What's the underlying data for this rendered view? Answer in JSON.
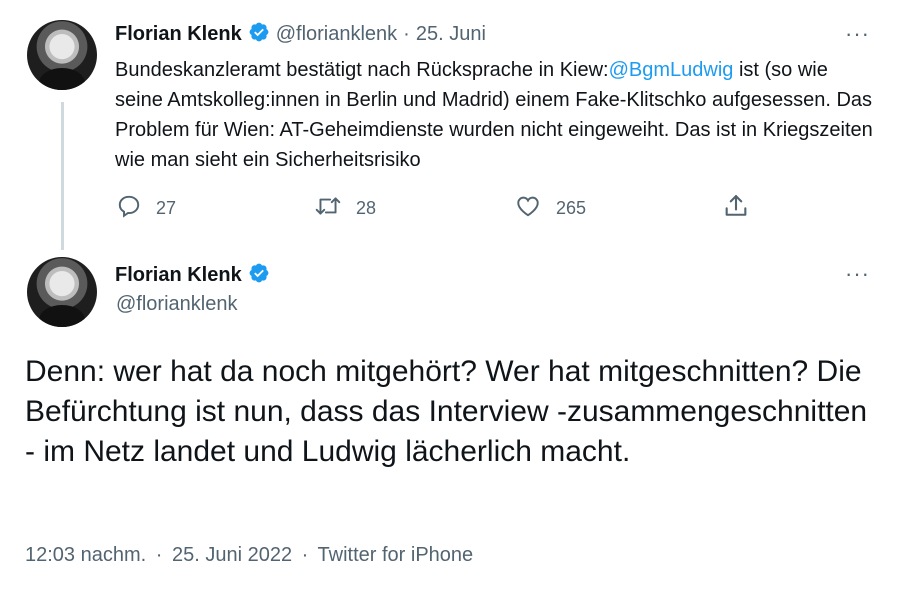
{
  "tweet1": {
    "author_name": "Florian Klenk",
    "handle": "@florianklenk",
    "separator": "·",
    "date": "25. Juni",
    "text_before": "Bundeskanzleramt bestätigt nach Rücksprache in Kiew:",
    "mention": "@BgmLudwig",
    "text_after": " ist (so wie seine Amtskolleg:innen in Berlin und Madrid) einem Fake-Klitschko aufgesessen. Das Problem für Wien: AT-Geheimdienste wurden nicht eingeweiht. Das ist in Kriegszeiten wie man sieht ein Sicherheitsrisiko",
    "replies": "27",
    "retweets": "28",
    "likes": "265",
    "more_label": "···"
  },
  "tweet2": {
    "author_name": "Florian Klenk",
    "handle": "@florianklenk",
    "more_label": "···",
    "text": "Denn: wer hat da noch mitgehört? Wer hat mitgeschnitten? Die Befürchtung ist nun, dass das Interview -zusammengeschnitten - im Netz landet und Ludwig lächerlich macht.",
    "time": "12:03 nachm.",
    "date": "25. Juni 2022",
    "source": "Twitter for iPhone",
    "separator": "·"
  },
  "colors": {
    "accent": "#1d9bf0",
    "text": "#0f1419",
    "muted": "#536471",
    "thread_line": "#cfd9de"
  },
  "icons": [
    "verified-badge-icon",
    "more-icon",
    "reply-icon",
    "retweet-icon",
    "like-icon",
    "share-icon"
  ]
}
